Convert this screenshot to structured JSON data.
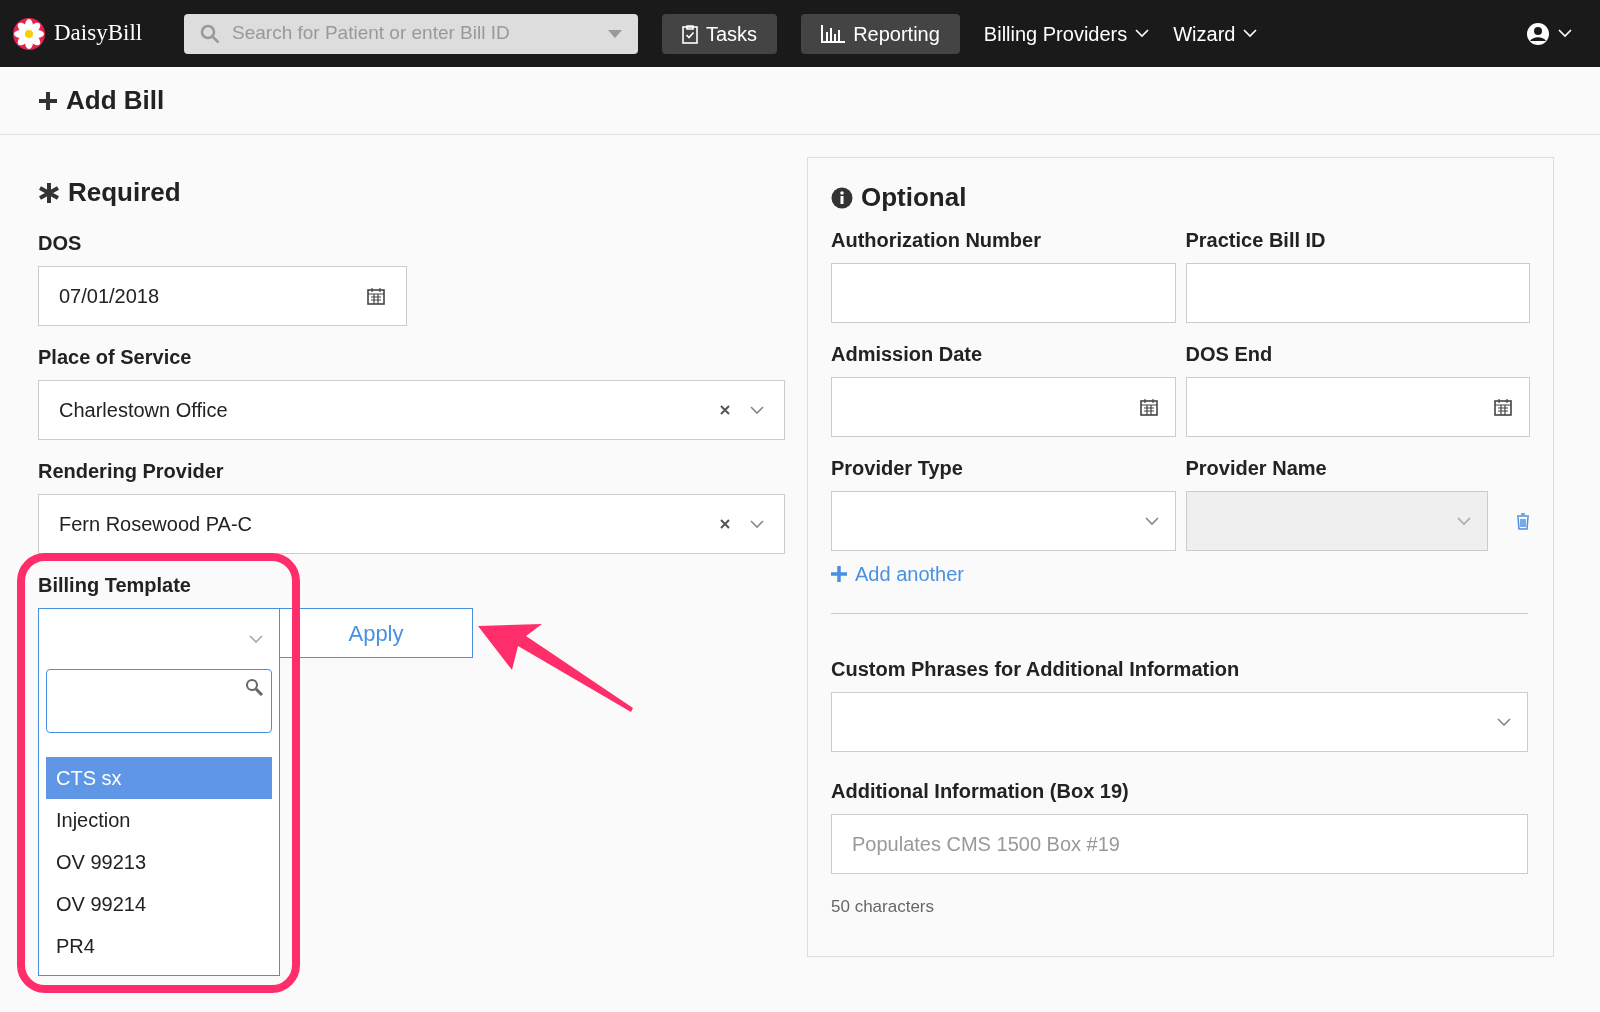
{
  "navbar": {
    "logo": "DaisyBill",
    "search": {
      "placeholder": "Search for Patient or enter Bill ID"
    },
    "buttons": [
      {
        "label": "Tasks",
        "kind": "tasks"
      },
      {
        "label": "Reporting",
        "kind": "reporting"
      }
    ],
    "menus": [
      "Billing Providers",
      "Wizard"
    ]
  },
  "page_title": "Add Bill",
  "required": {
    "title": "Required",
    "dos": {
      "label": "DOS",
      "value": "07/01/2018"
    },
    "selects": [
      {
        "label": "Place of Service",
        "value": "Charlestown Office"
      },
      {
        "label": "Rendering Provider",
        "value": "Fern Rosewood PA-C"
      }
    ],
    "billing_template": {
      "label": "Billing Template",
      "expanded": true,
      "apply": "Apply",
      "options": [
        {
          "label": "CTS sx",
          "selected": true
        },
        {
          "label": "Injection",
          "selected": false
        },
        {
          "label": "OV 99213",
          "selected": false
        },
        {
          "label": "OV 99214",
          "selected": false
        },
        {
          "label": "PR4",
          "selected": false
        }
      ]
    }
  },
  "optional": {
    "title": "Optional",
    "rows": [
      [
        {
          "label": "Authorization Number",
          "kind": "text"
        },
        {
          "label": "Practice Bill ID",
          "kind": "text"
        }
      ],
      [
        {
          "label": "Admission Date",
          "kind": "date"
        },
        {
          "label": "DOS End",
          "kind": "date"
        }
      ],
      [
        {
          "label": "Provider Type",
          "kind": "select"
        },
        {
          "label": "Provider Name",
          "kind": "disabled-select"
        }
      ]
    ],
    "add_another": "Add another",
    "custom_phrases": {
      "label": "Custom Phrases for Additional Information"
    },
    "additional_info": {
      "label": "Additional Information (Box 19)",
      "placeholder": "Populates CMS 1500 Box #19",
      "hint": "50 characters"
    }
  }
}
